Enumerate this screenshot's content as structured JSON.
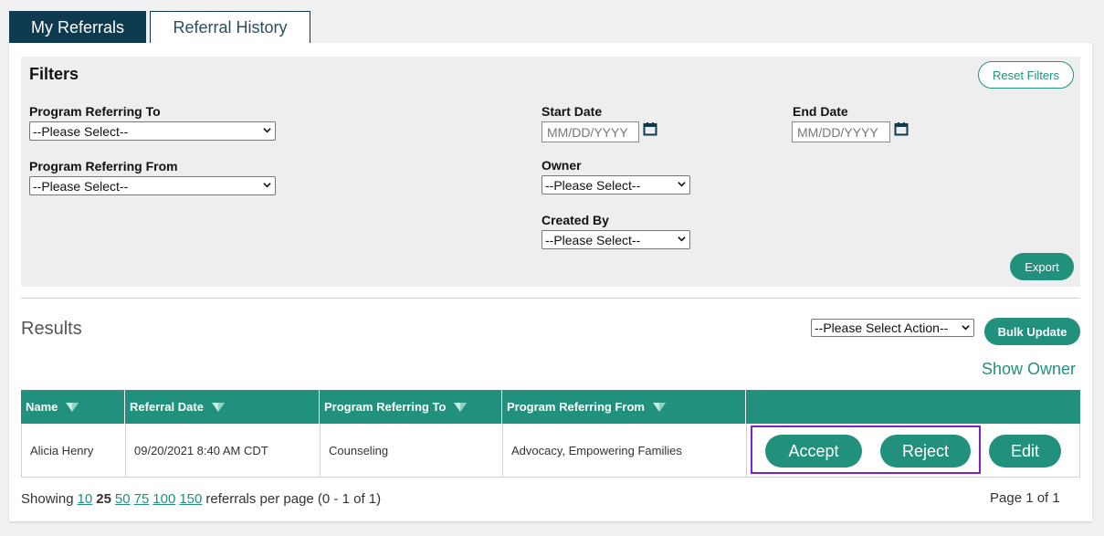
{
  "tabs": [
    {
      "label": "My Referrals",
      "active": true
    },
    {
      "label": "Referral History",
      "active": false
    }
  ],
  "filters": {
    "title": "Filters",
    "reset_label": "Reset Filters",
    "program_referring_to": {
      "label": "Program Referring To",
      "value": "--Please Select--"
    },
    "program_referring_from": {
      "label": "Program Referring From",
      "value": "--Please Select--"
    },
    "start_date": {
      "label": "Start Date",
      "placeholder": "MM/DD/YYYY"
    },
    "end_date": {
      "label": "End Date",
      "placeholder": "MM/DD/YYYY"
    },
    "owner": {
      "label": "Owner",
      "value": "--Please Select--"
    },
    "created_by": {
      "label": "Created By",
      "value": "--Please Select--"
    },
    "export_label": "Export"
  },
  "results": {
    "title": "Results",
    "action_select": "--Please Select Action--",
    "bulk_update_label": "Bulk Update",
    "show_owner_label": "Show Owner"
  },
  "table": {
    "headers": [
      "Name",
      "Referral Date",
      "Program Referring To",
      "Program Referring From",
      ""
    ],
    "rows": [
      {
        "name": "Alicia Henry",
        "referral_date": "09/20/2021 8:40 AM CDT",
        "program_to": "Counseling",
        "program_from": "Advocacy, Empowering Families",
        "actions": {
          "accept": "Accept",
          "reject": "Reject",
          "edit": "Edit"
        }
      }
    ]
  },
  "pagination": {
    "prefix": "Showing",
    "sizes": [
      "10",
      "25",
      "50",
      "75",
      "100",
      "150"
    ],
    "current_size": "25",
    "suffix": "referrals per page (0 - 1 of 1)",
    "page_of": "Page 1 of 1"
  },
  "colors": {
    "primary": "#21907c",
    "tab_dark": "#0e3a4f",
    "highlight": "#7b22c7"
  },
  "icons": {
    "calendar": "calendar-icon",
    "sort": "sort-icon",
    "dropdown": "chevron-down-icon"
  }
}
